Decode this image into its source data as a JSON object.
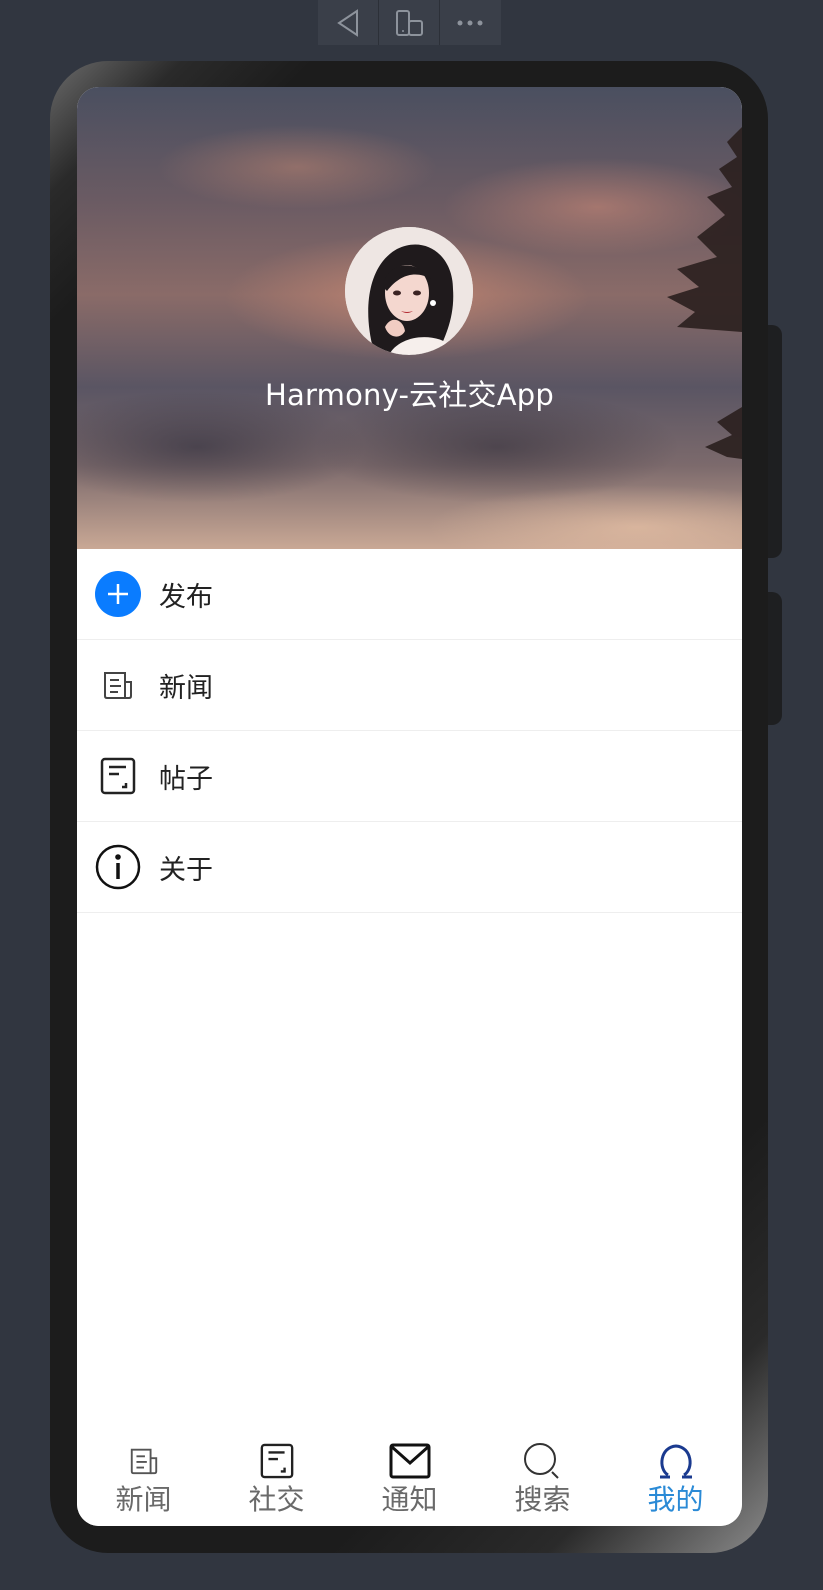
{
  "toolbar": {
    "icons": [
      "back-triangle-icon",
      "device-rotate-icon",
      "more-dots-icon"
    ]
  },
  "profile": {
    "avatar_icon": "profile-avatar",
    "app_title": "Harmony-云社交App"
  },
  "menu": {
    "items": [
      {
        "label": "发布",
        "icon": "add-circle-icon"
      },
      {
        "label": "新闻",
        "icon": "news-icon"
      },
      {
        "label": "帖子",
        "icon": "post-icon"
      },
      {
        "label": "关于",
        "icon": "info-icon"
      }
    ]
  },
  "tabs": {
    "items": [
      {
        "label": "新闻",
        "icon": "news-icon",
        "active": false
      },
      {
        "label": "社交",
        "icon": "post-icon",
        "active": false
      },
      {
        "label": "通知",
        "icon": "mail-icon",
        "active": false
      },
      {
        "label": "搜索",
        "icon": "search-icon",
        "active": false
      },
      {
        "label": "我的",
        "icon": "person-icon",
        "active": true
      }
    ]
  },
  "colors": {
    "background": "#313640",
    "accent_blue": "#0a7cff",
    "tab_active": "#2a8ad6",
    "tab_inactive": "#6a6a6a",
    "person_icon": "#1a3a8f"
  }
}
